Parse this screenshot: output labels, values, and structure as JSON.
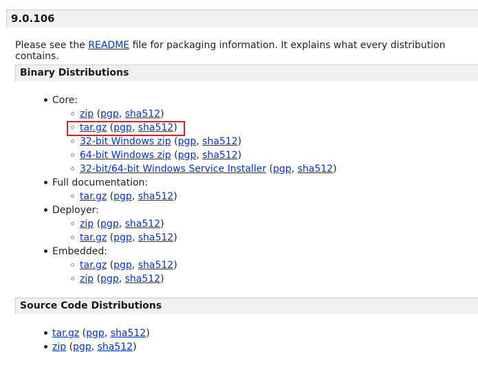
{
  "version": "9.0.106",
  "intro": {
    "before": "Please see the ",
    "link": "README",
    "after": " file for packaging information. It explains what every distribution contains."
  },
  "binary": {
    "title": "Binary Distributions",
    "core_label": "Core:",
    "core": [
      {
        "name": "zip",
        "pgp": "pgp",
        "sha": "sha512"
      },
      {
        "name": "tar.gz",
        "pgp": "pgp",
        "sha": "sha512"
      },
      {
        "name": "32-bit Windows zip",
        "pgp": "pgp",
        "sha": "sha512"
      },
      {
        "name": "64-bit Windows zip",
        "pgp": "pgp",
        "sha": "sha512"
      },
      {
        "name": "32-bit/64-bit Windows Service Installer",
        "pgp": "pgp",
        "sha": "sha512"
      }
    ],
    "fulldoc_label": "Full documentation:",
    "fulldoc": [
      {
        "name": "tar.gz",
        "pgp": "pgp",
        "sha": "sha512"
      }
    ],
    "deployer_label": "Deployer:",
    "deployer": [
      {
        "name": "zip",
        "pgp": "pgp",
        "sha": "sha512"
      },
      {
        "name": "tar.gz",
        "pgp": "pgp",
        "sha": "sha512"
      }
    ],
    "embedded_label": "Embedded:",
    "embedded": [
      {
        "name": "tar.gz",
        "pgp": "pgp",
        "sha": "sha512"
      },
      {
        "name": "zip",
        "pgp": "pgp",
        "sha": "sha512"
      }
    ]
  },
  "source": {
    "title": "Source Code Distributions",
    "items": [
      {
        "name": "tar.gz",
        "pgp": "pgp",
        "sha": "sha512"
      },
      {
        "name": "zip",
        "pgp": "pgp",
        "sha": "sha512"
      }
    ]
  },
  "punct": {
    "open": " (",
    "comma": ", ",
    "close": ")"
  },
  "highlight_color": "#e02020",
  "link_color": "#0033cc"
}
